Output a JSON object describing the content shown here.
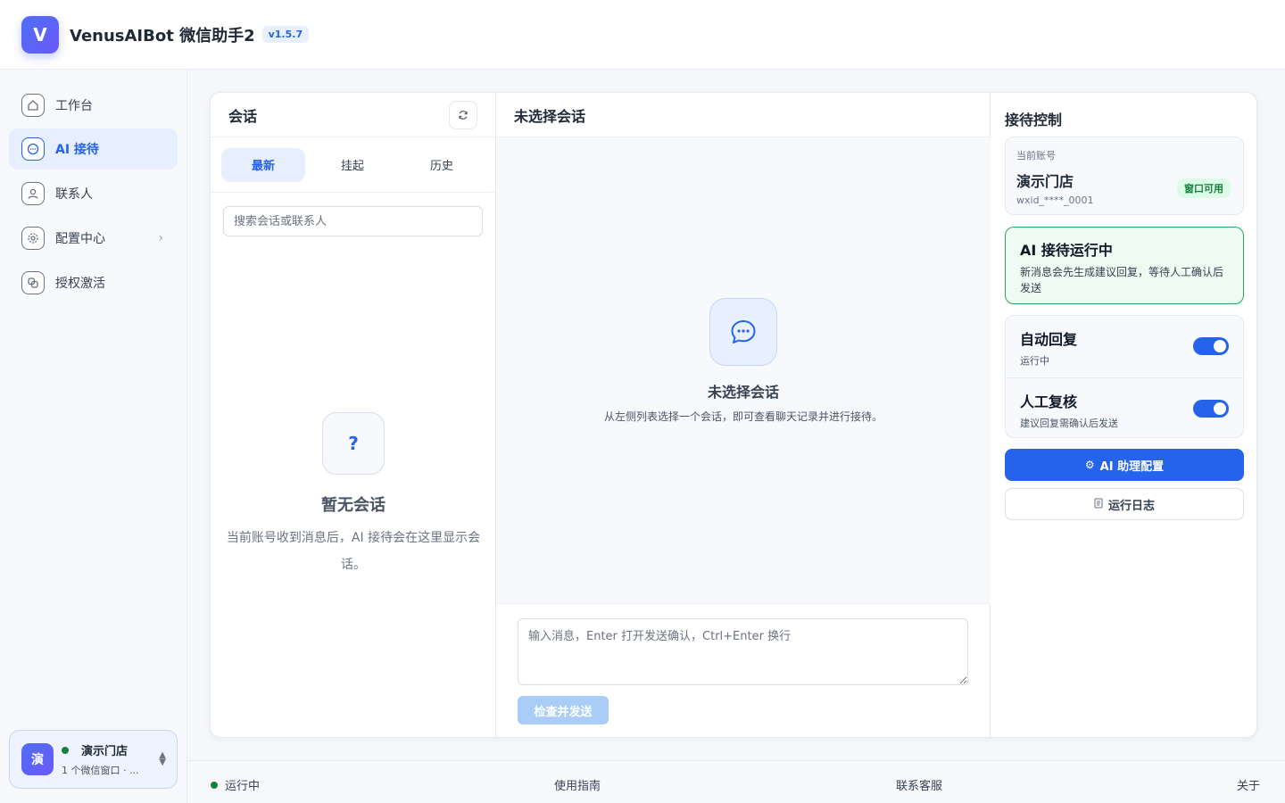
{
  "app": {
    "logo_letter": "V",
    "title": "VenusAIBot 微信助手2",
    "version": "v1.5.7"
  },
  "sidebar": {
    "items": [
      {
        "label": "工作台",
        "icon": "home-icon"
      },
      {
        "label": "AI 接待",
        "icon": "chat-icon",
        "active": true
      },
      {
        "label": "联系人",
        "icon": "user-icon"
      },
      {
        "label": "配置中心",
        "icon": "gear-icon",
        "has_submenu": true
      },
      {
        "label": "授权激活",
        "icon": "link-icon"
      }
    ],
    "account": {
      "avatar_text": "演",
      "name": "演示门店",
      "sub": "1 个微信窗口 · ...",
      "status_color": "#15803d"
    }
  },
  "conversations": {
    "title": "会话",
    "tabs": [
      "最新",
      "挂起",
      "历史"
    ],
    "active_tab": "最新",
    "search_placeholder": "搜索会话或联系人",
    "empty_icon": "?",
    "empty_title": "暂无会话",
    "empty_desc": "当前账号收到消息后，AI 接待会在这里显示会话。"
  },
  "chat": {
    "header": "未选择会话",
    "empty_title": "未选择会话",
    "empty_desc": "从左侧列表选择一个会话，即可查看聊天记录并进行接待。",
    "input_placeholder": "输入消息，Enter 打开发送确认，Ctrl+Enter 换行",
    "send_label": "检查并发送"
  },
  "control": {
    "title": "接待控制",
    "current_account": {
      "label": "当前账号",
      "name": "演示门店",
      "id": "wxid_****_0001",
      "badge": "窗口可用"
    },
    "running": {
      "title": "AI 接待运行中",
      "desc": "新消息会先生成建议回复，等待人工确认后发送"
    },
    "toggles": [
      {
        "title": "自动回复",
        "sub": "运行中",
        "on": true
      },
      {
        "title": "人工复核",
        "sub": "建议回复需确认后发送",
        "on": true
      }
    ],
    "ai_config_label": "AI 助理配置",
    "log_label": "运行日志"
  },
  "footer": {
    "status": "运行中",
    "guide": "使用指南",
    "support": "联系客服",
    "about": "关于"
  },
  "colors": {
    "primary": "#2563eb",
    "success": "#15803d",
    "disabled_button": "#a9cdf7"
  }
}
